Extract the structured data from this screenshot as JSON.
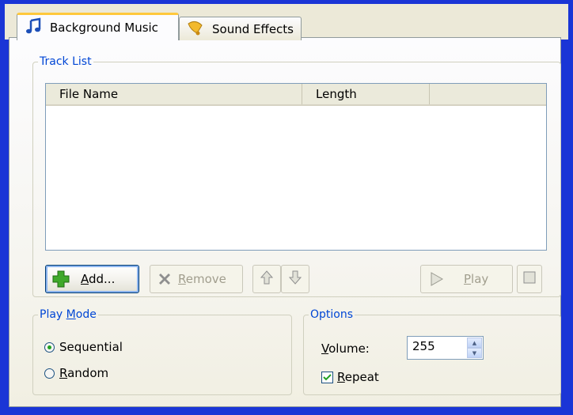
{
  "tabs": [
    {
      "label": "Background Music",
      "icon": "music-note-icon",
      "active": true
    },
    {
      "label": "Sound Effects",
      "icon": "bell-icon",
      "active": false
    }
  ],
  "track_list": {
    "title": "Track List",
    "columns": [
      "File Name",
      "Length"
    ],
    "rows": []
  },
  "buttons": {
    "add": {
      "prefix": "",
      "mnemonic": "A",
      "rest": "dd..."
    },
    "remove": {
      "prefix": "",
      "mnemonic": "R",
      "rest": "emove"
    },
    "play": {
      "prefix": "",
      "mnemonic": "P",
      "rest": "lay"
    }
  },
  "play_mode": {
    "title_prefix": "Play ",
    "title_mnemonic": "M",
    "title_rest": "ode",
    "options": [
      {
        "label": "Sequential",
        "selected": true
      },
      {
        "mnemonic": "R",
        "rest": "andom",
        "selected": false
      }
    ]
  },
  "options": {
    "title": "Options",
    "volume_mnemonic": "V",
    "volume_rest": "olume:",
    "volume_value": "255",
    "repeat_mnemonic": "R",
    "repeat_rest": "epeat",
    "repeat_checked": true
  },
  "colors": {
    "window_frame": "#1a35d6",
    "group_title": "#0046d5",
    "tab_highlight": "#ffc83c",
    "add_icon": "#3fa82a"
  }
}
